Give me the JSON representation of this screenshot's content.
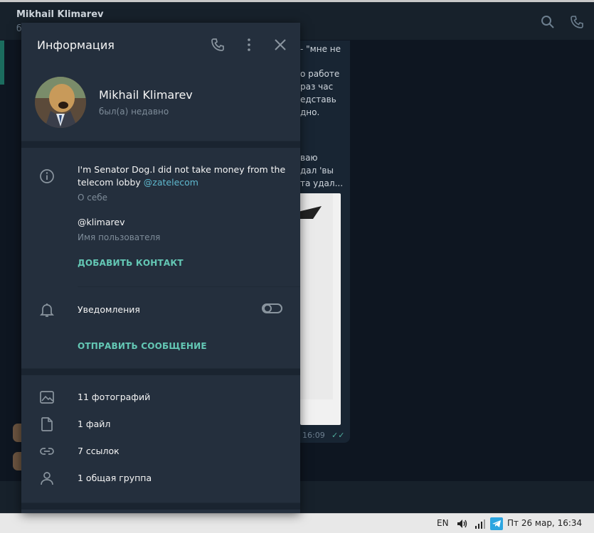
{
  "chat": {
    "title": "Mikhail Klimarev",
    "subtitle": "б",
    "bubble_lines": [
      "- \"мне не",
      "о работе",
      "раз час",
      "едставь",
      "дно.",
      "ваю",
      "дал 'вы",
      "та удал..."
    ],
    "time": "16:09",
    "check": "✓✓"
  },
  "panel": {
    "title": "Информация",
    "name": "Mikhail Klimarev",
    "status": "был(а) недавно",
    "bio_line1": "I'm Senator Dog.I did not take money from the",
    "bio_line2_prefix": "telecom lobby ",
    "bio_mention": "@zatelecom",
    "bio_caption": "О себе",
    "username": "@klimarev",
    "username_caption": "Имя пользователя",
    "add_contact": "ДОБАВИТЬ КОНТАКТ",
    "notifications_label": "Уведомления",
    "notifications_on": false,
    "send_message": "ОТПРАВИТЬ СООБЩЕНИЕ",
    "media": [
      {
        "icon": "photo-icon",
        "label": "11 фотографий"
      },
      {
        "icon": "file-icon",
        "label": "1 файл"
      },
      {
        "icon": "link-icon",
        "label": "7 ссылок"
      },
      {
        "icon": "group-icon",
        "label": "1 общая группа"
      }
    ]
  },
  "taskbar": {
    "lang": "EN",
    "clock": "Пт 26 мар, 16:34"
  },
  "colors": {
    "panel_bg": "#242f3d",
    "accent": "#64c8b5",
    "link": "#5fb9cf"
  }
}
